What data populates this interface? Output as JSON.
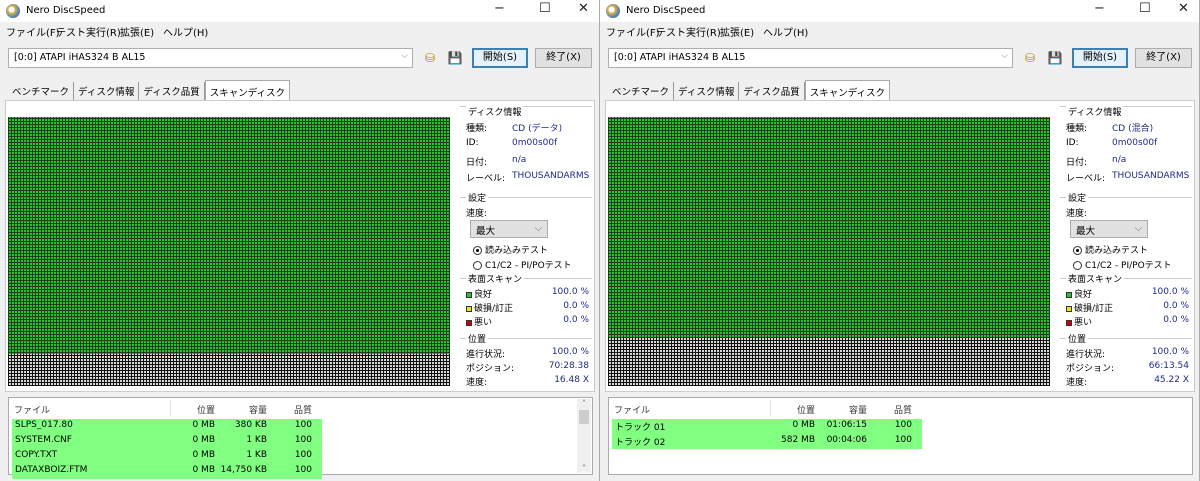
{
  "common": {
    "title": "Nero DiscSpeed",
    "window_controls": {
      "minimize": "−",
      "maximize": "☐",
      "close": "✕"
    },
    "menu": [
      "ファイル(F)",
      "テスト実行(R)",
      "拡張(E)",
      "ヘルプ(H)"
    ],
    "drive": "[0:0]   ATAPI iHAS324   B AL15",
    "start": "開始(S)",
    "exit": "終了(X)",
    "tabs": [
      "ベンチマーク",
      "ディスク情報",
      "ディスク品質",
      "スキャンディスク"
    ],
    "disc_info_title": "ディスク情報",
    "type_label": "種類:",
    "id_label": "ID:",
    "date_label": "日付:",
    "label_label": "レーベル:",
    "settings_title": "設定",
    "speed_label": "速度:",
    "speed_value": "最大",
    "radio_read": "読み込みテスト",
    "radio_c1c2": "C1/C2 - PI/POテスト",
    "surface_title": "表面スキャン",
    "good": "良好",
    "damaged": "破損/訂正",
    "bad": "悪い",
    "position_title": "位置",
    "progress_label": "進行状況:",
    "position_label": "ポジション:",
    "speed2_label": "速度:",
    "columns": [
      "ファイル",
      "位置",
      "容量",
      "品質"
    ],
    "colors": {
      "good": "#27c427",
      "damaged": "#e8e800",
      "bad": "#cc0000",
      "row": "#80ff80"
    }
  },
  "windows": [
    {
      "type": "CD (データ)",
      "id": "0m00s00f",
      "date": "n/a",
      "label": "THOUSANDARMS",
      "good_pct": "100.0 %",
      "damaged_pct": "0.0 %",
      "bad_pct": "0.0 %",
      "progress": "100.0 %",
      "position": "70:28.38",
      "speed": "16.48 X",
      "scanned_fraction": 0.88,
      "rows": [
        [
          "SLPS_017.80",
          "0 MB",
          "380 KB",
          "100"
        ],
        [
          "SYSTEM.CNF",
          "0 MB",
          "1 KB",
          "100"
        ],
        [
          "COPY.TXT",
          "0 MB",
          "1 KB",
          "100"
        ],
        [
          "DATAXBOIZ.FTM",
          "0 MB",
          "14,750 KB",
          "100"
        ]
      ],
      "scroll": true
    },
    {
      "type": "CD (混合)",
      "id": "0m00s00f",
      "date": "n/a",
      "label": "THOUSANDARMS",
      "good_pct": "100.0 %",
      "damaged_pct": "0.0 %",
      "bad_pct": "0.0 %",
      "progress": "100.0 %",
      "position": "66:13.54",
      "speed": "45.22 X",
      "scanned_fraction": 0.82,
      "rows": [
        [
          "トラック 01",
          "0 MB",
          "01:06:15",
          "100"
        ],
        [
          "トラック 02",
          "582 MB",
          "00:04:06",
          "100"
        ]
      ],
      "scroll": false
    }
  ]
}
